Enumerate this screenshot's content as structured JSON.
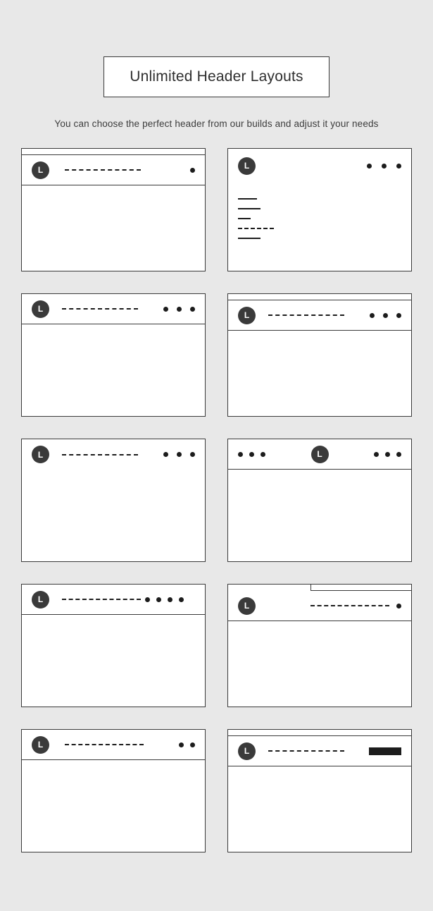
{
  "page": {
    "background_color": "#e8e8e8",
    "card_background_color": "#ffffff",
    "ink_color": "#1c1c1c",
    "border_color": "#3a3a3a"
  },
  "header": {
    "title": "Unlimited Header Layouts",
    "subtitle": "You can choose the perfect header from our builds and adjust it your needs"
  },
  "logo": {
    "letter": "L"
  },
  "cards": [
    {
      "id": "card-1",
      "name": "header-layout-topbar-logo-left-nav-center-single-dot",
      "top_strip": "full",
      "header_divider": true,
      "logo_position": "left",
      "nav": "dashed",
      "right_items": "dots",
      "dot_count": 1
    },
    {
      "id": "card-2",
      "name": "header-layout-vertical-sidebar-menu",
      "top_strip": "none",
      "header_divider": false,
      "logo_position": "left",
      "nav": "vertical-stack",
      "right_items": "dots",
      "dot_count": 3,
      "menu_lines": [
        "short",
        "medium",
        "tiny",
        "dashed-long",
        "medium"
      ]
    },
    {
      "id": "card-3",
      "name": "header-layout-logo-left-nav-center-three-dots",
      "top_strip": "none",
      "header_divider": true,
      "logo_position": "left",
      "nav": "dashed",
      "right_items": "dots",
      "dot_count": 3
    },
    {
      "id": "card-4",
      "name": "header-layout-topbar-logo-left-nav-three-dots",
      "top_strip": "full",
      "header_divider": true,
      "logo_position": "left",
      "nav": "dashed",
      "right_items": "dots",
      "dot_count": 3
    },
    {
      "id": "card-5",
      "name": "header-layout-transparent-logo-left-nav-three-dots",
      "top_strip": "none",
      "header_divider": false,
      "logo_position": "left",
      "nav": "dashed",
      "right_items": "dots",
      "dot_count": 3
    },
    {
      "id": "card-6",
      "name": "header-layout-centered-logo-split-nav",
      "top_strip": "none",
      "header_divider": true,
      "logo_position": "center",
      "nav": "split-dots",
      "left_dot_count": 3,
      "right_items": "dots",
      "dot_count": 3
    },
    {
      "id": "card-7",
      "name": "header-layout-logo-left-nav-four-dots",
      "top_strip": "none",
      "header_divider": true,
      "logo_position": "left",
      "nav": "dashed",
      "right_items": "dots",
      "dot_count": 4
    },
    {
      "id": "card-8",
      "name": "header-layout-partial-topbar-logo-left-single-dot",
      "top_strip": "partial",
      "header_divider": true,
      "logo_position": "left",
      "nav": "dashed",
      "right_items": "dots",
      "dot_count": 1
    },
    {
      "id": "card-9",
      "name": "header-layout-logo-left-nav-two-dots",
      "top_strip": "none",
      "header_divider": true,
      "logo_position": "left",
      "nav": "dashed",
      "right_items": "dots",
      "dot_count": 2
    },
    {
      "id": "card-10",
      "name": "header-layout-topbar-logo-left-nav-cta-button",
      "top_strip": "full",
      "header_divider": true,
      "logo_position": "left",
      "nav": "dashed",
      "right_items": "cta-button",
      "dot_count": 0
    }
  ]
}
